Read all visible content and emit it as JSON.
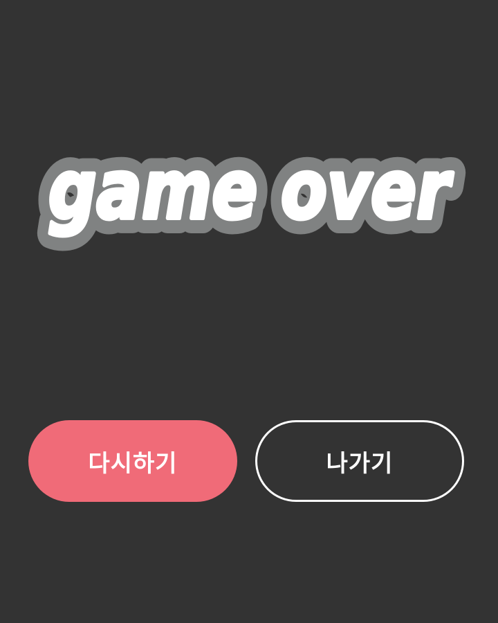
{
  "screen": "game-over",
  "title": {
    "text": "game over"
  },
  "buttons": {
    "retry_label": "다시하기",
    "exit_label": "나가기"
  },
  "colors": {
    "background": "#333333",
    "title_fill": "#ffffff",
    "title_outline": "#808282",
    "retry_button": "#f06b78",
    "exit_button_border": "#ffffff"
  }
}
